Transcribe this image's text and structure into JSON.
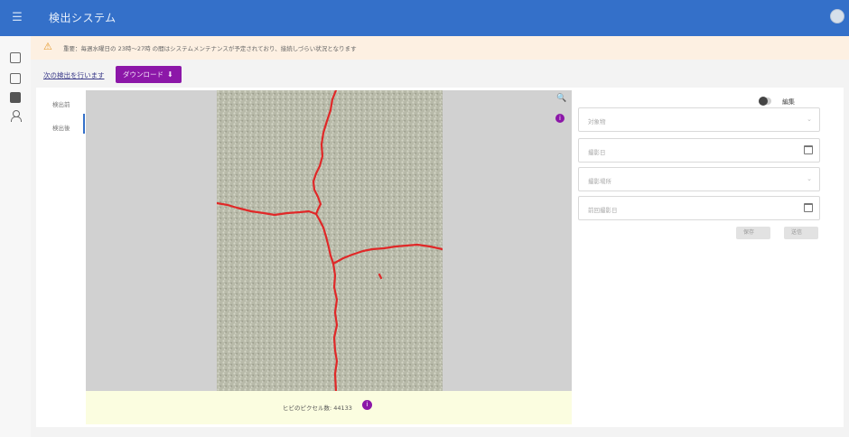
{
  "app": {
    "title": "検出システム",
    "menu_icon": "menu-icon",
    "avatar_icon": "avatar-icon"
  },
  "rail": {
    "icons": [
      "calendar-icon",
      "clipboard-icon",
      "image-icon",
      "user-icon"
    ]
  },
  "notice": {
    "icon": "warning-icon",
    "text": "重要：毎週水曜日の 23時〜27時 の間はシステムメンテナンスが予定されており、接続しづらい状況となります"
  },
  "actions": {
    "link_label": "次の検出を行います",
    "download_label": "ダウンロード",
    "download_icon": "download-icon"
  },
  "tabs": [
    {
      "label": "検出前"
    },
    {
      "label": "検出後",
      "selected": true
    }
  ],
  "viewer": {
    "zoom_icon": "zoom-icon",
    "info_icon": "info-icon",
    "result_label": "ヒビのピクセル数: 44133"
  },
  "side": {
    "toggle_label": "編集",
    "toggle_on": false,
    "fields": [
      {
        "placeholder": "対象物",
        "kind": "select"
      },
      {
        "placeholder": "撮影日",
        "kind": "date"
      },
      {
        "placeholder": "撮影場所",
        "kind": "select"
      },
      {
        "placeholder": "前回撮影日",
        "kind": "date"
      }
    ],
    "buttons": [
      {
        "label": "保存"
      },
      {
        "label": "送信"
      }
    ]
  }
}
